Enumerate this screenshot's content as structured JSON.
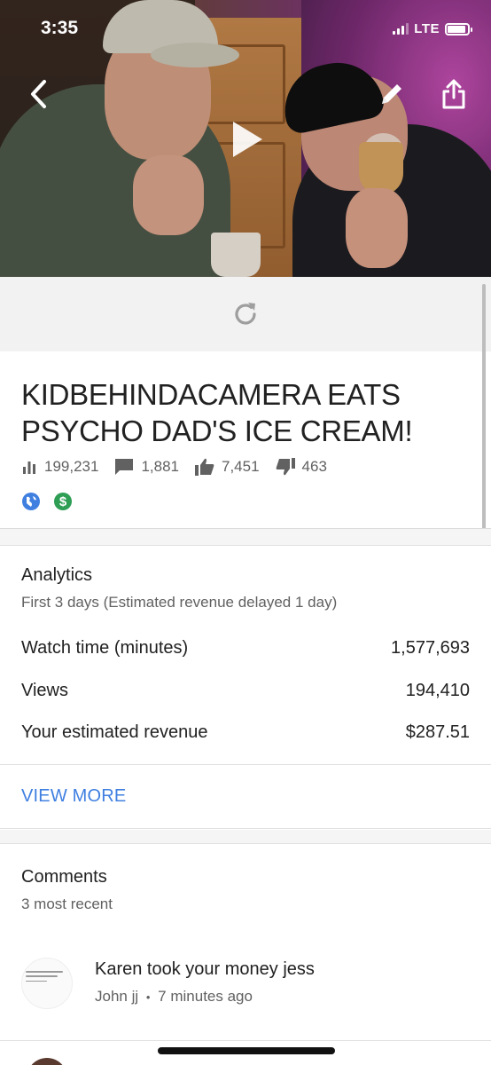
{
  "status_bar": {
    "time": "3:35",
    "network": "LTE",
    "signal_bars": 3,
    "signal_bars_total": 4,
    "battery_level": 0.9
  },
  "video": {
    "title": "KIDBEHINDACAMERA EATS PSYCHO DAD'S ICE CREAM!",
    "stats": {
      "views": "199,231",
      "comments": "1,881",
      "likes": "7,451",
      "dislikes": "463"
    },
    "badges": [
      "globe-icon",
      "dollar-icon"
    ]
  },
  "analytics": {
    "title": "Analytics",
    "subtitle": "First 3 days (Estimated revenue delayed 1 day)",
    "rows": [
      {
        "label": "Watch time (minutes)",
        "value": "1,577,693"
      },
      {
        "label": "Views",
        "value": "194,410"
      },
      {
        "label": "Your estimated revenue",
        "value": "$287.51"
      }
    ],
    "view_more": "VIEW MORE"
  },
  "comments": {
    "title": "Comments",
    "subtitle": "3 most recent",
    "items": [
      {
        "text": "Karen took your money jess",
        "author": "John jj",
        "separator": "•",
        "time": "7 minutes ago"
      }
    ]
  },
  "colors": {
    "accent": "#3f7fe0",
    "globe": "#3f7fe0",
    "dollar": "#2e9e55",
    "text": "#212121",
    "secondary": "#616161"
  }
}
